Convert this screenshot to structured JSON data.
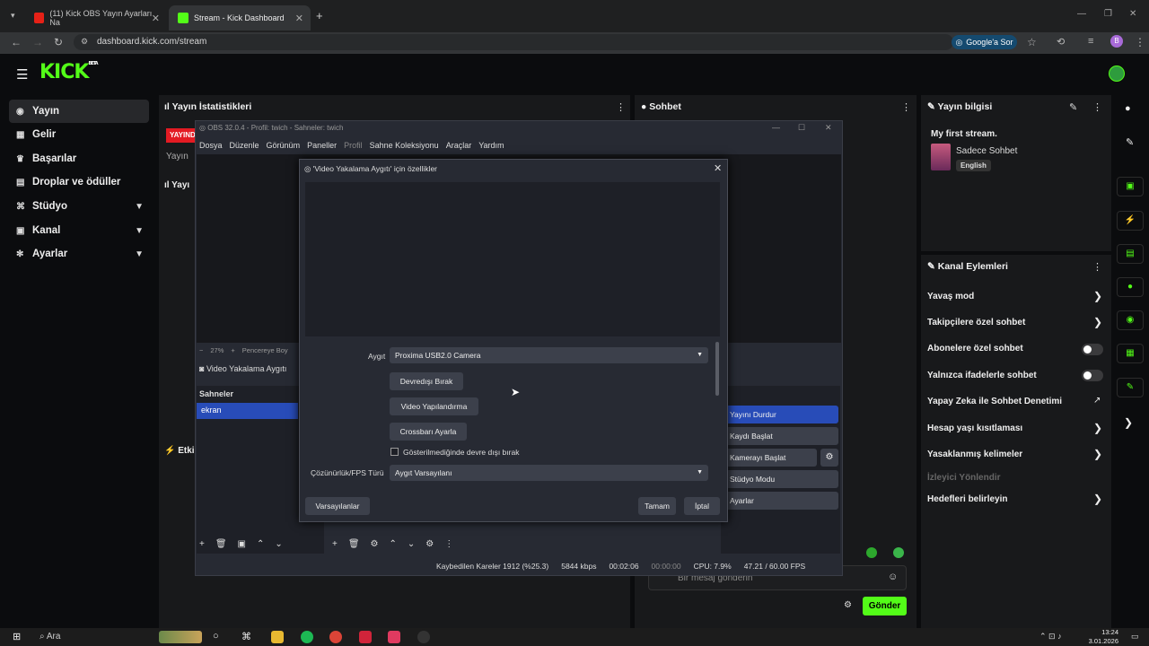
{
  "browser": {
    "tabs": [
      {
        "title": "(11) Kick OBS Yayın Ayarları Na"
      },
      {
        "title": "Stream - Kick Dashboard"
      }
    ],
    "url": "dashboard.kick.com/stream",
    "google_ask": "Google'a Sor",
    "profile_initial": "B"
  },
  "kick": {
    "logo": "KICK",
    "logo_badge": "BETA",
    "menu": [
      {
        "label": "Yayın",
        "icon": "broadcast-icon"
      },
      {
        "label": "Gelir",
        "icon": "revenue-icon"
      },
      {
        "label": "Başarılar",
        "icon": "trophy-icon"
      },
      {
        "label": "Droplar ve ödüller",
        "icon": "drops-icon"
      },
      {
        "label": "Stüdyo",
        "icon": "studio-icon"
      },
      {
        "label": "Kanal",
        "icon": "channel-icon"
      },
      {
        "label": "Ayarlar",
        "icon": "settings-icon"
      }
    ],
    "stats_panel": {
      "title": "Yayın İstatistikleri",
      "live_badge": "YAYIND",
      "sub": "Yayın",
      "sub2": "Yayı",
      "etkin": "Etkin"
    },
    "chat_panel": {
      "title": "Sohbet",
      "placeholder": "Bir mesaj gönderin",
      "send": "Gönder"
    },
    "stream_info": {
      "title": "Yayın bilgisi",
      "stream_title": "My first stream.",
      "category": "Sadece Sohbet",
      "language": "English"
    },
    "channel_actions": {
      "title": "Kanal Eylemleri",
      "items": [
        {
          "label": "Yavaş mod",
          "control": "arrow"
        },
        {
          "label": "Takipçilere özel sohbet",
          "control": "arrow"
        },
        {
          "label": "Abonelere özel sohbet",
          "control": "toggle"
        },
        {
          "label": "Yalnızca ifadelerle sohbet",
          "control": "toggle"
        },
        {
          "label": "Yapay Zeka ile Sohbet Denetimi",
          "control": "external"
        },
        {
          "label": "Hesap yaşı kısıtlaması",
          "control": "arrow"
        },
        {
          "label": "Yasaklanmış kelimeler",
          "control": "arrow"
        },
        {
          "label": "İzleyici Yönlendir",
          "control": "none"
        },
        {
          "label": "Hedefleri belirleyin",
          "control": "arrow"
        }
      ]
    },
    "accent": "#53fc18"
  },
  "obs": {
    "title": "OBS 32.0.4 - Profil: twich - Sahneler: twich",
    "menu": [
      "Dosya",
      "Düzenle",
      "Görünüm",
      "Paneller",
      "Profil",
      "Sahne Koleksiyonu",
      "Araçlar",
      "Yardım"
    ],
    "zoom": "27%",
    "zoom_mode": "Pencereye Boy",
    "source_label": "Video Yakalama Aygıtı",
    "scenes_title": "Sahneler",
    "scene": "ekran",
    "controls": [
      "Yayını Durdur",
      "Kaydı Başlat",
      "Kamerayı Başlat",
      "Stüdyo Modu",
      "Ayarlar"
    ],
    "status": {
      "dropped": "Kaybedilen Kareler 1912 (%25.3)",
      "bitrate": "5844 kbps",
      "stream_time": "00:02:06",
      "rec_time": "00:00:00",
      "cpu": "CPU: 7.9%",
      "fps": "47.21 / 60.00 FPS"
    }
  },
  "dialog": {
    "title": "'Video Yakalama Aygıtı' için özellikler",
    "device_label": "Aygıt",
    "device_value": "Proxima USB2.0 Camera",
    "btn_disable": "Devredışı Bırak",
    "btn_configure": "Video Yapılandırma",
    "btn_crossbar": "Crossbarı Ayarla",
    "checkbox_label": "Gösterilmediğinde devre dışı bırak",
    "res_label": "Çözünürlük/FPS Türü",
    "res_value": "Aygıt Varsayılanı",
    "btn_defaults": "Varsayılanlar",
    "btn_ok": "Tamam",
    "btn_cancel": "İptal"
  },
  "taskbar": {
    "search": "Ara",
    "time": "13:24",
    "date": "3.01.2026"
  }
}
